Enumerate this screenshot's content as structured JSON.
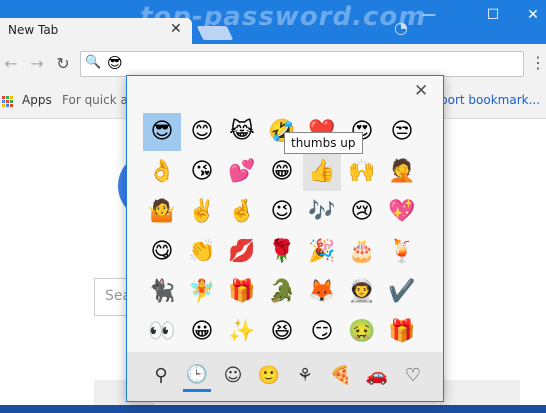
{
  "window": {
    "watermark": "top-password.com",
    "tab_title": "New Tab",
    "tab_close": "✕",
    "minimize": "—",
    "maximize": "☐",
    "close": "✕"
  },
  "toolbar": {
    "back": "←",
    "forward": "→",
    "reload": "↻",
    "search_glyph": "🔍",
    "omnibox_value": "😎",
    "menu": "⋮"
  },
  "bookmarks": {
    "apps_label": "Apps",
    "hint": "For quick ac",
    "hint_right": "port bookmark..."
  },
  "page": {
    "search_placeholder": "Sea"
  },
  "emoji_panel": {
    "close": "✕",
    "tooltip": "thumbs up",
    "selected_index": 0,
    "hovered_index": 11,
    "rows": [
      [
        "😎",
        "😊",
        "😹",
        "🤣",
        "❤️",
        "😍",
        "😒"
      ],
      [
        "👌",
        "😘",
        "💕",
        "😁",
        "👍",
        "🙌",
        "🤦"
      ],
      [
        "🤷",
        "✌️",
        "🤞",
        "😉",
        "🎶",
        "😢",
        "💖"
      ],
      [
        "😋",
        "👏",
        "💋",
        "🌹",
        "🎉",
        "🎂",
        "🍹"
      ],
      [
        "🐈‍⬛",
        "🧚",
        "🎁",
        "🐊",
        "🦊",
        "👨‍🚀",
        "✔️"
      ],
      [
        "👀",
        "😀",
        "✨",
        "😆",
        "😏",
        "🤢",
        "🎁"
      ]
    ],
    "categories": [
      {
        "name": "search",
        "glyph": "⚲"
      },
      {
        "name": "recent",
        "glyph": "🕒"
      },
      {
        "name": "smiley",
        "glyph": "☺"
      },
      {
        "name": "people",
        "glyph": "🙂"
      },
      {
        "name": "nature",
        "glyph": "⚘"
      },
      {
        "name": "food",
        "glyph": "🍕"
      },
      {
        "name": "travel",
        "glyph": "🚗"
      },
      {
        "name": "symbols",
        "glyph": "♡"
      }
    ],
    "active_category": 1
  }
}
